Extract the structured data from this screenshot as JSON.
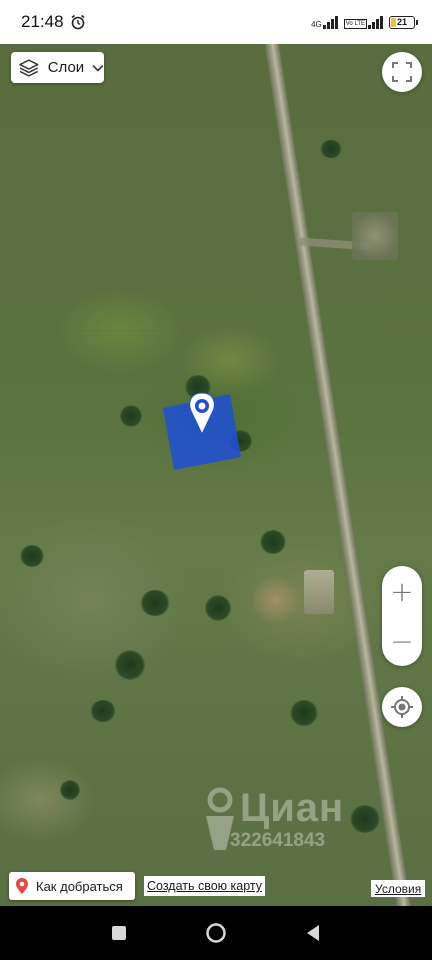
{
  "status_bar": {
    "time": "21:48",
    "network_primary": "4G",
    "network_secondary": "Vo LTE",
    "battery_level": "21",
    "battery_fraction": 0.21
  },
  "map": {
    "layers_label": "Слои",
    "fullscreen_icon": "fullscreen-icon",
    "zoom_in_label": "+",
    "zoom_out_label": "−",
    "locate_icon": "locate-icon",
    "marker_icon": "map-marker-icon",
    "parcel_color": "#1f4fd6",
    "watermark_brand": "Циан",
    "watermark_phone": "322641843"
  },
  "footer": {
    "route_label": "Как добраться",
    "create_map_label": "Создать свою карту",
    "terms_label": "Условия"
  },
  "nav": {
    "recents_icon": "square-icon",
    "home_icon": "circle-icon",
    "back_icon": "triangle-back-icon"
  }
}
